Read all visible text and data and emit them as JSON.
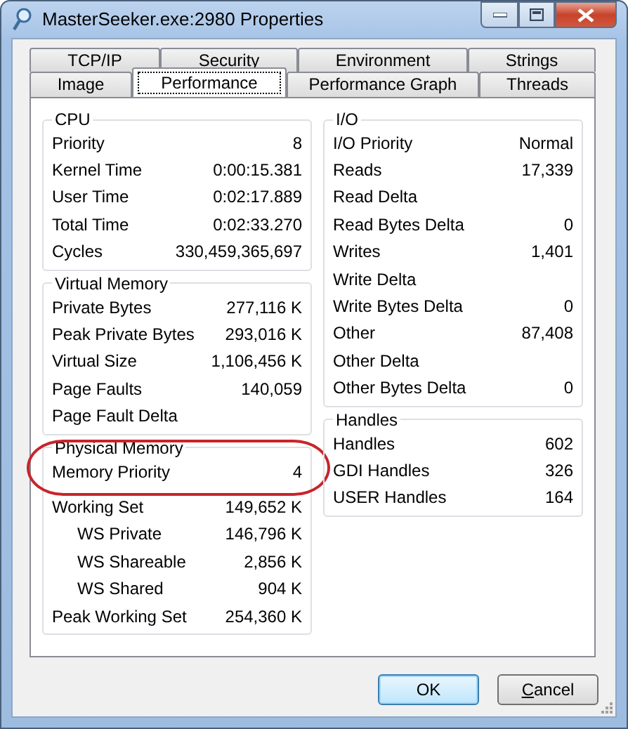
{
  "window": {
    "title": "MasterSeeker.exe:2980 Properties"
  },
  "tab_rows": [
    {
      "tabs": [
        {
          "label": "TCP/IP",
          "selected": false
        },
        {
          "label": "Security",
          "selected": false
        },
        {
          "label": "Environment",
          "selected": false
        },
        {
          "label": "Strings",
          "selected": false
        }
      ]
    },
    {
      "tabs": [
        {
          "label": "Image",
          "selected": false
        },
        {
          "label": "Performance",
          "selected": true
        },
        {
          "label": "Performance Graph",
          "selected": false
        },
        {
          "label": "Threads",
          "selected": false
        }
      ]
    }
  ],
  "columns": [
    {
      "groups": [
        {
          "title": "CPU",
          "circled": false,
          "rows": [
            {
              "label": "Priority",
              "value": "8"
            },
            {
              "label": "Kernel Time",
              "value": "0:00:15.381"
            },
            {
              "label": "User Time",
              "value": "0:02:17.889"
            },
            {
              "label": "Total Time",
              "value": "0:02:33.270"
            },
            {
              "label": "Cycles",
              "value": "330,459,365,697"
            }
          ]
        },
        {
          "title": "Virtual Memory",
          "circled": false,
          "rows": [
            {
              "label": "Private Bytes",
              "value": "277,116 K"
            },
            {
              "label": "Peak Private Bytes",
              "value": "293,016 K"
            },
            {
              "label": "Virtual Size",
              "value": "1,106,456 K"
            },
            {
              "label": "Page Faults",
              "value": "140,059"
            },
            {
              "label": "Page Fault Delta"
            }
          ]
        },
        {
          "title": "Physical Memory",
          "circled": true,
          "rows": [
            {
              "label": "Memory Priority",
              "value": "4"
            },
            {
              "label": "Working Set",
              "value": "149,652 K",
              "children": [
                {
                  "label": "WS Private",
                  "value": "146,796 K"
                },
                {
                  "label": "WS Shareable",
                  "value": "2,856 K"
                },
                {
                  "label": "WS Shared",
                  "value": "904 K"
                }
              ]
            },
            {
              "label": "Peak Working Set",
              "value": "254,360 K"
            }
          ]
        }
      ]
    },
    {
      "groups": [
        {
          "title": "I/O",
          "circled": false,
          "rows": [
            {
              "label": "I/O Priority",
              "value": "Normal"
            },
            {
              "label": "Reads",
              "value": "17,339"
            },
            {
              "label": "Read Delta"
            },
            {
              "label": "Read Bytes Delta",
              "value": "0"
            },
            {
              "label": "Writes",
              "value": "1,401"
            },
            {
              "label": "Write Delta"
            },
            {
              "label": "Write Bytes Delta",
              "value": "0"
            },
            {
              "label": "Other",
              "value": "87,408"
            },
            {
              "label": "Other Delta"
            },
            {
              "label": "Other Bytes Delta",
              "value": "0"
            }
          ]
        },
        {
          "title": "Handles",
          "circled": false,
          "rows": [
            {
              "label": "Handles",
              "value": "602"
            },
            {
              "label": "GDI Handles",
              "value": "326"
            },
            {
              "label": "USER Handles",
              "value": "164"
            }
          ]
        }
      ]
    }
  ],
  "buttons": [
    {
      "label": "OK",
      "default": true,
      "underline_first": false
    },
    {
      "label": "Cancel",
      "default": false,
      "underline_first": true
    }
  ]
}
